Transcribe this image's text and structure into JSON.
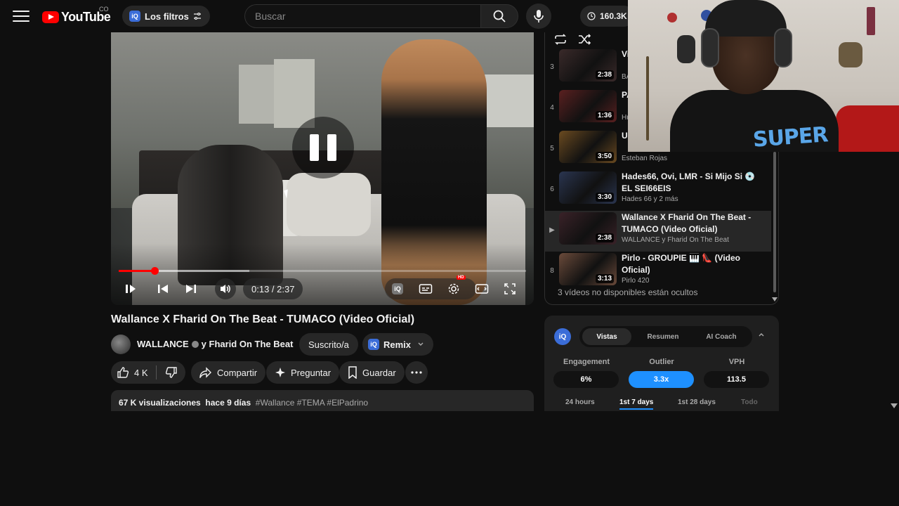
{
  "header": {
    "logo_text": "YouTube",
    "country": "CO",
    "filters_label": "Los filtros",
    "iq_badge": "iQ",
    "search_placeholder": "Buscar",
    "subs_count": "160.3K"
  },
  "player": {
    "time": "0:13 / 2:37",
    "progress_fraction": 0.088,
    "buffer_fraction": 0.32,
    "hd_badge": "HD",
    "iq_badge": "iQ"
  },
  "video": {
    "title": "Wallance X Fharid On The Beat - TUMACO (Video Oficial)",
    "channel": "WALLANCE",
    "channel_suffix": "y Fharid On The Beat",
    "subscribe_label": "Suscrito/a",
    "remix_label": "Remix",
    "remix_badge": "iQ",
    "likes": "4 K",
    "share_label": "Compartir",
    "ask_label": "Preguntar",
    "save_label": "Guardar",
    "views": "67 K visualizaciones",
    "age": "hace 9 días",
    "tags": "#Wallance #TEMA #ElPadrino"
  },
  "playlist": {
    "items": [
      {
        "index": "3",
        "title": "Vi",
        "channel": "BA",
        "duration": "2:38",
        "thumb": "#3a2a2a"
      },
      {
        "index": "4",
        "title": "PA of",
        "channel": "Hu",
        "duration": "1:36",
        "thumb": "#5a2020"
      },
      {
        "index": "5",
        "title": "Ul @",
        "channel": "Esteban Rojas",
        "duration": "3:50",
        "thumb": "#6a4a20"
      },
      {
        "index": "6",
        "title": "Hades66, Ovi, LMR - Si Mijo Si 💿 EL SEI66EIS",
        "channel": "Hades 66 y 2 más",
        "duration": "3:30",
        "thumb": "#2a3550"
      },
      {
        "index": "▶",
        "title": "Wallance X Fharid On The Beat - TUMACO (Video Oficial)",
        "channel": "WALLANCE y Fharid On The Beat",
        "duration": "2:38",
        "thumb": "#3a2228",
        "active": true
      },
      {
        "index": "8",
        "title": "Pirlo - GROUPIE 🎹 👠 (Video Oficial)",
        "channel": "Pirlo 420",
        "duration": "3:13",
        "thumb": "#6a4a3a"
      }
    ],
    "hidden_note": "3 vídeos no disponibles están ocultos"
  },
  "analytics": {
    "logo": "iQ",
    "tabs": [
      "Vistas",
      "Resumen",
      "AI Coach"
    ],
    "metrics": [
      {
        "label": "Engagement",
        "value": "6%"
      },
      {
        "label": "Outlier",
        "value": "3.3x"
      },
      {
        "label": "VPH",
        "value": "113.5"
      }
    ],
    "ranges": [
      "24 hours",
      "1st 7 days",
      "1st 28 days",
      "Todo"
    ]
  },
  "webcam": {
    "shirt_text": "SUPER"
  },
  "colors": {
    "accent_red": "#ff0000",
    "iq_blue": "#3b6dd8",
    "highlight_blue": "#1e90ff"
  }
}
